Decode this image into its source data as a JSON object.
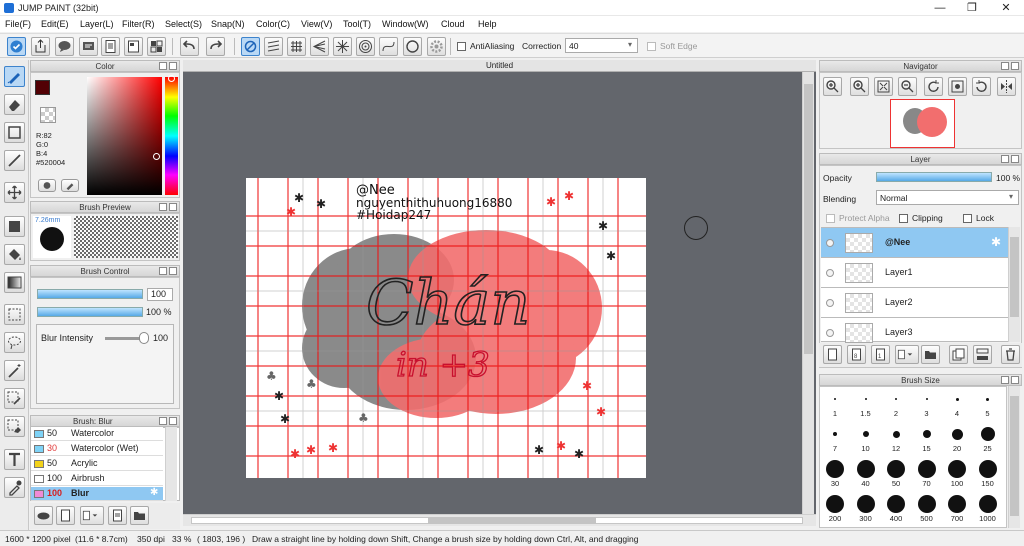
{
  "window": {
    "title": "JUMP PAINT (32bit)",
    "minimize": "—",
    "maximize": "❐",
    "close": "✕"
  },
  "menu": [
    "File(F)",
    "Edit(E)",
    "Layer(L)",
    "Filter(R)",
    "Select(S)",
    "Snap(N)",
    "Color(C)",
    "View(V)",
    "Tool(T)",
    "Window(W)",
    "Cloud",
    "Help"
  ],
  "toolbar": {
    "antialiasing_label": "AntiAliasing",
    "correction_label": "Correction",
    "correction_value": "40",
    "soft_edge_label": "Soft Edge"
  },
  "color_panel": {
    "title": "Color",
    "r": "R:82",
    "g": "G:0",
    "b": "B:4",
    "hex": "#520004",
    "current_color": "#520004"
  },
  "brush_preview": {
    "title": "Brush Preview",
    "size": "7.26mm"
  },
  "brush_control": {
    "title": "Brush Control",
    "size_value": "100",
    "opacity_value": "100 %",
    "blur_label": "Blur Intensity",
    "blur_value": "100"
  },
  "brush_list": {
    "title": "Brush: Blur",
    "items": [
      {
        "size": "50",
        "name": "Watercolor",
        "color": "#7fd3f7"
      },
      {
        "size": "30",
        "name": "Watercolor (Wet)",
        "color": "#7fd3f7"
      },
      {
        "size": "50",
        "name": "Acrylic",
        "color": "#f2d21a"
      },
      {
        "size": "100",
        "name": "Airbrush",
        "color": "#ffffff"
      },
      {
        "size": "100",
        "name": "Blur",
        "color": "#f08ad6"
      }
    ]
  },
  "canvas": {
    "tab_title": "Untitled",
    "text_lines": [
      "@Nee",
      "nguyenthithuhuong16880",
      "#Hoidap247"
    ],
    "big_word": "Chán",
    "sub_word": "in +3"
  },
  "navigator": {
    "title": "Navigator"
  },
  "layer_panel": {
    "title": "Layer",
    "opacity_label": "Opacity",
    "opacity_value": "100 %",
    "blending_label": "Blending",
    "blending_value": "Normal",
    "protect_alpha": "Protect Alpha",
    "clipping": "Clipping",
    "lock": "Lock",
    "layers": [
      "@Nee",
      "Layer1",
      "Layer2",
      "Layer3"
    ]
  },
  "brush_size": {
    "title": "Brush Size",
    "sizes": [
      "1",
      "1.5",
      "2",
      "3",
      "4",
      "5",
      "7",
      "10",
      "12",
      "15",
      "20",
      "25",
      "30",
      "40",
      "50",
      "70",
      "100",
      "150",
      "200",
      "300",
      "400",
      "500",
      "700",
      "1000"
    ]
  },
  "status": {
    "dims": "1600 * 1200 pixel",
    "mm": "(11.6 * 8.7cm)",
    "dpi": "350 dpi",
    "zoom": "33 %",
    "coords": "( 1803, 196 )",
    "hint": "Draw a straight line by holding down Shift, Change a brush size by holding down Ctrl, Alt, and dragging"
  }
}
